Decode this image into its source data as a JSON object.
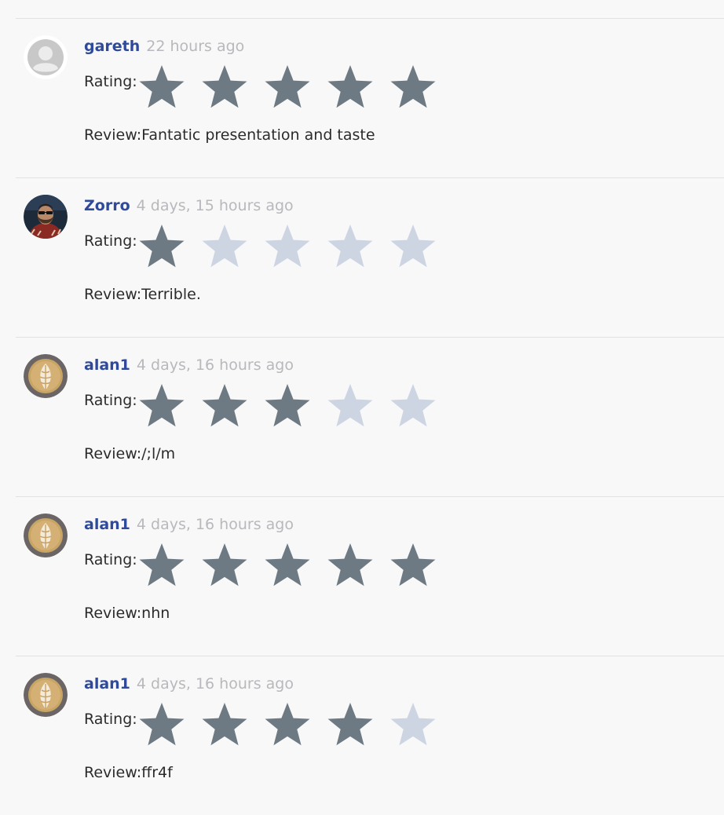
{
  "reviews": [
    {
      "author": "gareth",
      "time": "22 hours ago",
      "rating_label": "Rating:",
      "rating": 5,
      "max_rating": 5,
      "review_label": "Review:",
      "review_text": "Fantatic presentation and taste",
      "avatar_icon": "default-user-avatar-icon"
    },
    {
      "author": "Zorro",
      "time": "4 days, 15 hours ago",
      "rating_label": "Rating:",
      "rating": 1,
      "max_rating": 5,
      "review_label": "Review:",
      "review_text": "Terrible.",
      "avatar_icon": "bearded-man-photo-avatar"
    },
    {
      "author": "alan1",
      "time": "4 days, 16 hours ago",
      "rating_label": "Rating:",
      "rating": 3,
      "max_rating": 5,
      "review_label": "Review:",
      "review_text": "/;l/m",
      "avatar_icon": "latte-art-photo-avatar"
    },
    {
      "author": "alan1",
      "time": "4 days, 16 hours ago",
      "rating_label": "Rating:",
      "rating": 5,
      "max_rating": 5,
      "review_label": "Review:",
      "review_text": "nhn",
      "avatar_icon": "latte-art-photo-avatar"
    },
    {
      "author": "alan1",
      "time": "4 days, 16 hours ago",
      "rating_label": "Rating:",
      "rating": 4,
      "max_rating": 5,
      "review_label": "Review:",
      "review_text": "ffr4f",
      "avatar_icon": "latte-art-photo-avatar"
    }
  ],
  "colors": {
    "author": "#2f4a9a",
    "time": "#b8b8bd",
    "star_filled": "#6e7a83",
    "star_empty": "#cdd5e3",
    "divider": "#e2e2e2",
    "background": "#f8f8f8"
  }
}
